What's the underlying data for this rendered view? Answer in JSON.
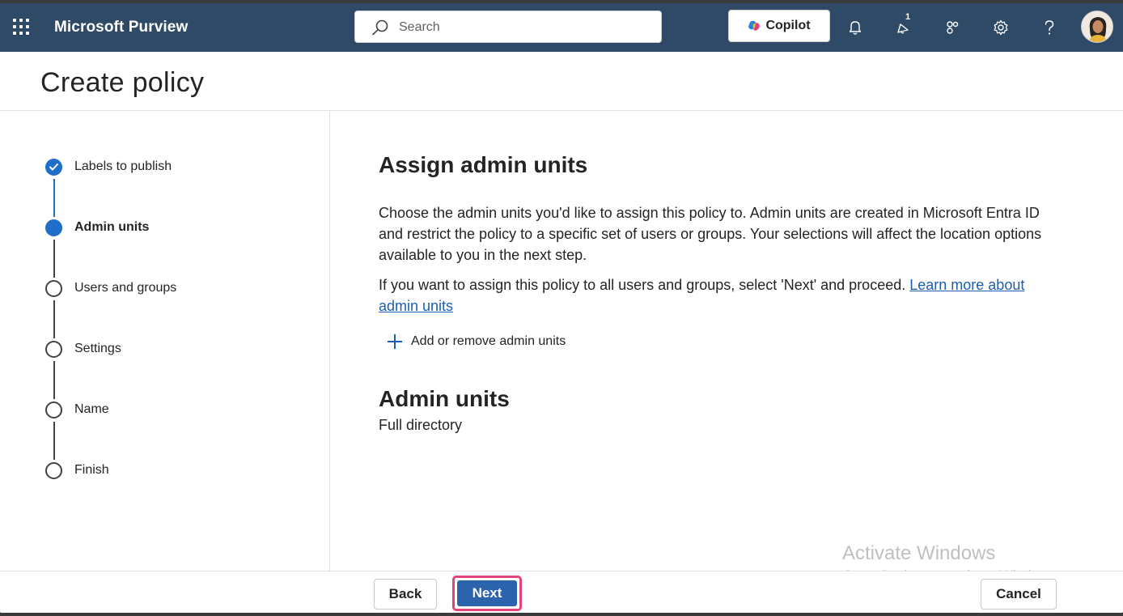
{
  "topbar": {
    "app_title": "Microsoft Purview",
    "search_placeholder": "Search",
    "copilot_label": "Copilot",
    "notification_badge": "1",
    "bg_color": "#2f4a66"
  },
  "header": {
    "title": "Create policy"
  },
  "stepper": {
    "steps": [
      {
        "label": "Labels to publish",
        "state": "done"
      },
      {
        "label": "Admin units",
        "state": "active"
      },
      {
        "label": "Users and groups",
        "state": "pending"
      },
      {
        "label": "Settings",
        "state": "pending"
      },
      {
        "label": "Name",
        "state": "pending"
      },
      {
        "label": "Finish",
        "state": "pending"
      }
    ]
  },
  "main": {
    "heading": "Assign admin units",
    "description": "Choose the admin units you'd like to assign this policy to. Admin units are created in Microsoft Entra ID and restrict the policy to a specific set of users or groups. Your selections will affect the location options available to you in the next step.",
    "instruction": "If you want to assign this policy to all users and groups, select 'Next' and proceed.",
    "learn_more_link": "Learn more about admin units",
    "add_remove_label": "Add or remove admin units",
    "admin_units_heading": "Admin units",
    "admin_units_value": "Full directory"
  },
  "footer": {
    "back_label": "Back",
    "next_label": "Next",
    "cancel_label": "Cancel"
  },
  "watermark": {
    "title": "Activate Windows",
    "subtitle": "Go to Settings to activate Windows."
  },
  "colors": {
    "accent": "#1f6ec7",
    "primary_button": "#2b64ad",
    "highlight": "#e0447a"
  }
}
